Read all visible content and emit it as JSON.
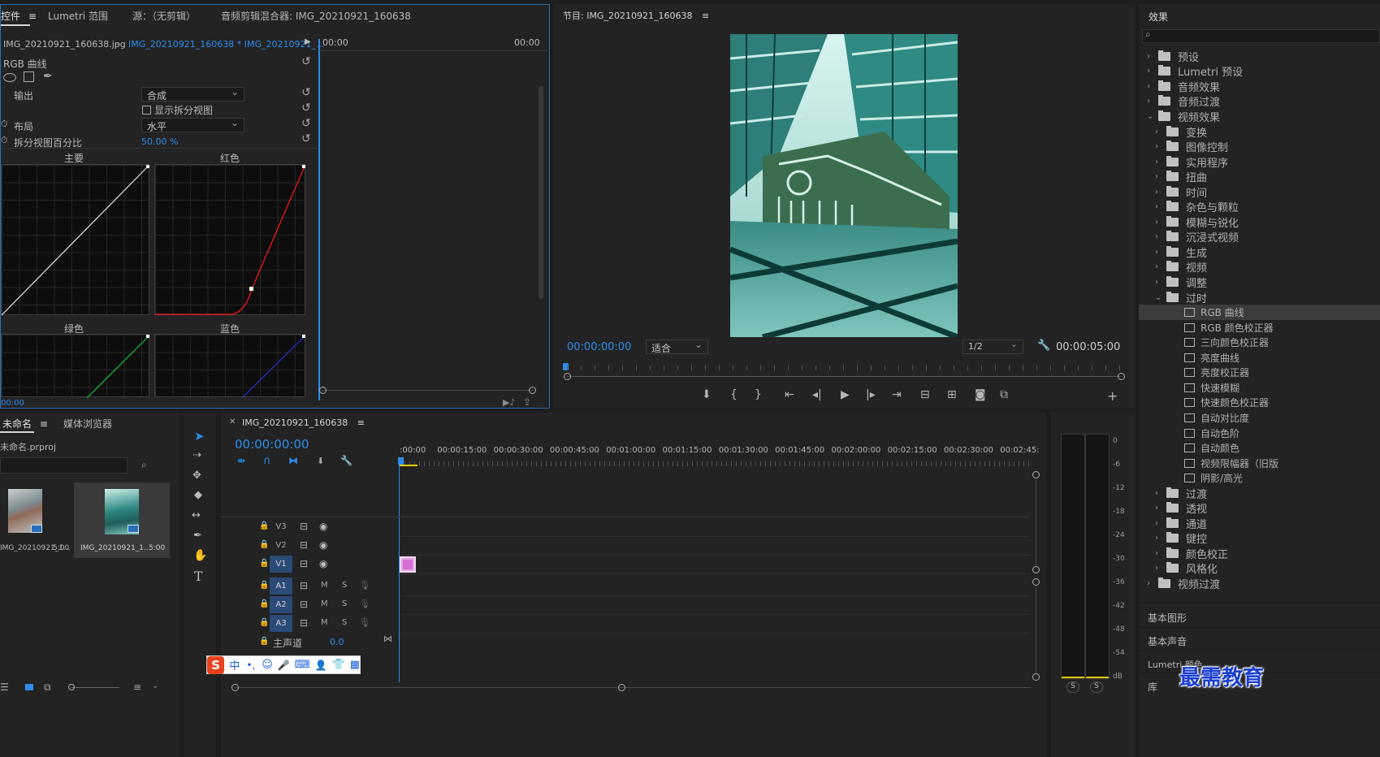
{
  "top_left_panel": {
    "tabs": [
      "控件",
      "Lumetri 范围",
      "源：（无剪辑）",
      "音频剪辑混合器: IMG_20210921_160638"
    ],
    "clip_source": "IMG_20210921_160638.jpg",
    "clip_sequence": "IMG_20210921_160638 * IMG_20210921_...",
    "tc_left": "00:00",
    "tc_right": "00:00",
    "effect_name": "RGB 曲线",
    "output_label": "输出",
    "output_value": "合成",
    "show_split_label": "显示拆分视图",
    "layout_label": "布局",
    "layout_value": "水平",
    "split_percent_label": "拆分视图百分比",
    "split_percent_value": "50.00 %",
    "curve_main": "主要",
    "curve_red": "红色",
    "curve_green": "绿色",
    "curve_blue": "蓝色",
    "bottom_tc": "00:00"
  },
  "program_monitor": {
    "title": "节目: IMG_20210921_160638",
    "timecode": "00:00:00:00",
    "fit_value": "适合",
    "resolution": "1/2",
    "duration": "00:00:05:00"
  },
  "effects_panel": {
    "title": "效果",
    "search_placeholder": "",
    "items": [
      {
        "label": "预设",
        "level": 0,
        "expanded": false,
        "kind": "preset"
      },
      {
        "label": "Lumetri 预设",
        "level": 0,
        "expanded": false,
        "kind": "preset"
      },
      {
        "label": "音频效果",
        "level": 0,
        "expanded": false,
        "kind": "folder"
      },
      {
        "label": "音频过渡",
        "level": 0,
        "expanded": false,
        "kind": "folder"
      },
      {
        "label": "视频效果",
        "level": 0,
        "expanded": true,
        "kind": "folder"
      },
      {
        "label": "变换",
        "level": 1,
        "expanded": false,
        "kind": "folder"
      },
      {
        "label": "图像控制",
        "level": 1,
        "expanded": false,
        "kind": "folder"
      },
      {
        "label": "实用程序",
        "level": 1,
        "expanded": false,
        "kind": "folder"
      },
      {
        "label": "扭曲",
        "level": 1,
        "expanded": false,
        "kind": "folder"
      },
      {
        "label": "时间",
        "level": 1,
        "expanded": false,
        "kind": "folder"
      },
      {
        "label": "杂色与颗粒",
        "level": 1,
        "expanded": false,
        "kind": "folder"
      },
      {
        "label": "模糊与锐化",
        "level": 1,
        "expanded": false,
        "kind": "folder"
      },
      {
        "label": "沉浸式视频",
        "level": 1,
        "expanded": false,
        "kind": "folder"
      },
      {
        "label": "生成",
        "level": 1,
        "expanded": false,
        "kind": "folder"
      },
      {
        "label": "视频",
        "level": 1,
        "expanded": false,
        "kind": "folder"
      },
      {
        "label": "调整",
        "level": 1,
        "expanded": false,
        "kind": "folder"
      },
      {
        "label": "过时",
        "level": 1,
        "expanded": true,
        "kind": "folder"
      },
      {
        "label": "RGB 曲线",
        "level": 2,
        "kind": "fx",
        "selected": true
      },
      {
        "label": "RGB 颜色校正器",
        "level": 2,
        "kind": "fx"
      },
      {
        "label": "三向颜色校正器",
        "level": 2,
        "kind": "fx"
      },
      {
        "label": "亮度曲线",
        "level": 2,
        "kind": "fx"
      },
      {
        "label": "亮度校正器",
        "level": 2,
        "kind": "fx"
      },
      {
        "label": "快速模糊",
        "level": 2,
        "kind": "fx"
      },
      {
        "label": "快速颜色校正器",
        "level": 2,
        "kind": "fx"
      },
      {
        "label": "自动对比度",
        "level": 2,
        "kind": "fx"
      },
      {
        "label": "自动色阶",
        "level": 2,
        "kind": "fx"
      },
      {
        "label": "自动颜色",
        "level": 2,
        "kind": "fx"
      },
      {
        "label": "视频限幅器（旧版",
        "level": 2,
        "kind": "fx"
      },
      {
        "label": "阴影/高光",
        "level": 2,
        "kind": "fx"
      },
      {
        "label": "过渡",
        "level": 1,
        "expanded": false,
        "kind": "folder"
      },
      {
        "label": "透视",
        "level": 1,
        "expanded": false,
        "kind": "folder"
      },
      {
        "label": "通道",
        "level": 1,
        "expanded": false,
        "kind": "folder"
      },
      {
        "label": "键控",
        "level": 1,
        "expanded": false,
        "kind": "folder"
      },
      {
        "label": "颜色校正",
        "level": 1,
        "expanded": false,
        "kind": "folder"
      },
      {
        "label": "风格化",
        "level": 1,
        "expanded": false,
        "kind": "folder"
      },
      {
        "label": "视频过渡",
        "level": 0,
        "expanded": false,
        "kind": "folder"
      }
    ],
    "bottom_panels": [
      "基本图形",
      "基本声音",
      "Lumetri 颜色",
      "库"
    ]
  },
  "project_panel": {
    "tabs": [
      "未命名",
      "媒体浏览器"
    ],
    "file": "未命名.prproj",
    "items": [
      {
        "name": "IMG_20210921_1...",
        "duration": "5:00"
      },
      {
        "name": "IMG_20210921_1...",
        "duration": "5:00"
      }
    ]
  },
  "timeline": {
    "tab": "IMG_20210921_160638",
    "timecode": "00:00:00:00",
    "ruler": [
      ":00:00",
      "00:00:15:00",
      "00:00:30:00",
      "00:00:45:00",
      "00:01:00:00",
      "00:01:15:00",
      "00:01:30:00",
      "00:01:45:00",
      "00:02:00:00",
      "00:02:15:00",
      "00:02:30:00",
      "00:02:45:"
    ],
    "video_tracks": [
      "V3",
      "V2",
      "V1"
    ],
    "audio_tracks": [
      "A1",
      "A2",
      "A3"
    ],
    "mute": "M",
    "solo": "S",
    "master_label": "主声道",
    "master_value": "0.0"
  },
  "audio_meter": {
    "scale": [
      "0",
      "-6",
      "-12",
      "-18",
      "-24",
      "-30",
      "-36",
      "-42",
      "-48",
      "-54",
      "dB"
    ],
    "solo_buttons": [
      "S",
      "S"
    ]
  },
  "ime_bar": {
    "mode": "中"
  },
  "watermark": "最需教育",
  "colors": {
    "accent": "#2d8ceb",
    "panel_bg": "#232323",
    "selection": "#3a3a3a"
  }
}
